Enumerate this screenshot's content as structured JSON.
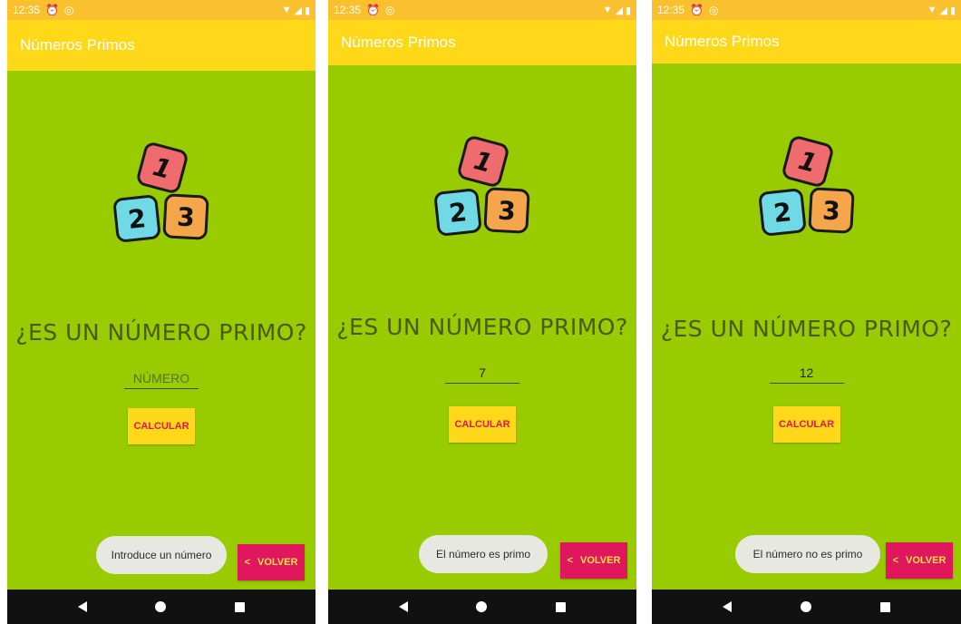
{
  "colors": {
    "background": "#98cc00",
    "status_bar": "#fbc02d",
    "app_bar": "#ffd819",
    "button": "#ffd819",
    "button_text": "#e0164d",
    "back_button": "#e0175d",
    "back_button_text": "#ffe14a",
    "question_text": "#4a5a12",
    "nav_bar": "#111111"
  },
  "logo": {
    "block1": {
      "label": "1",
      "color": "#ee6b6e"
    },
    "block2": {
      "label": "2",
      "color": "#6fd9e6"
    },
    "block3": {
      "label": "3",
      "color": "#f5a54a"
    }
  },
  "screens": [
    {
      "status_time": "12:35",
      "app_title": "Números Primos",
      "question": "¿ES UN NÚMERO PRIMO?",
      "input_value": "",
      "input_placeholder": "NÚMERO",
      "calc_label": "CALCULAR",
      "toast": "Introduce un número",
      "back_label": "VOLVER"
    },
    {
      "status_time": "12:35",
      "app_title": "Números Primos",
      "question": "¿ES UN NÚMERO PRIMO?",
      "input_value": "7",
      "input_placeholder": "NÚMERO",
      "calc_label": "CALCULAR",
      "toast": "El número es primo",
      "back_label": "VOLVER"
    },
    {
      "status_time": "12:35",
      "app_title": "Números Primos",
      "question": "¿ES UN NÚMERO PRIMO?",
      "input_value": "12",
      "input_placeholder": "NÚMERO",
      "calc_label": "CALCULAR",
      "toast": "El número no es primo",
      "back_label": "VOLVER"
    }
  ]
}
